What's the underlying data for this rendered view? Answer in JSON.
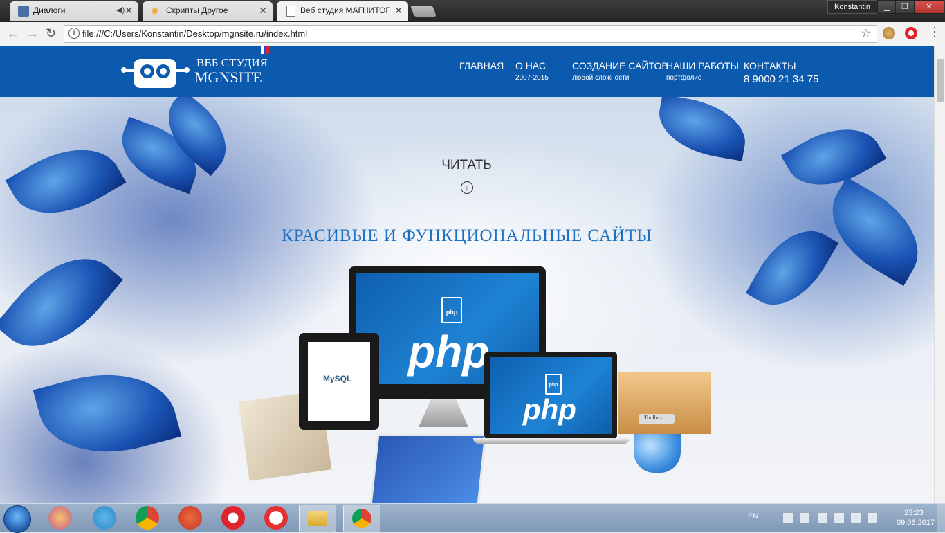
{
  "browser": {
    "tabs": [
      {
        "title": "Диалоги",
        "active": false,
        "audio": true
      },
      {
        "title": "Скрипты Другое",
        "active": false
      },
      {
        "title": "Веб студия МАГНИТОГС",
        "active": true
      }
    ],
    "user": "Konstantin",
    "url": "file:///C:/Users/Konstantin/Desktop/mgnsite.ru/index.html"
  },
  "site": {
    "logo_line1": "ВЕБ СТУДИЯ",
    "logo_line2": "MGNSITE",
    "nav": [
      {
        "label": "ГЛАВНАЯ",
        "sub": ""
      },
      {
        "label": "О НАС",
        "sub": "2007-2015"
      },
      {
        "label": "СОЗДАНИЕ САЙТОВ",
        "sub": "любой сложности"
      },
      {
        "label": "НАШИ РАБОТЫ",
        "sub": "портфолио"
      },
      {
        "label": "КОНТАКТЫ",
        "sub": "8 9000 21 34 75"
      }
    ],
    "read_label": "ЧИТАТЬ",
    "slogan": "КРАСИВЫЕ И ФУНКЦИОНАЛЬНЫЕ САЙТЫ",
    "hero": {
      "monitor_logo": "php",
      "file_icon": "php",
      "laptop_logo": "php",
      "tablet_logo": "MySQL",
      "toolbox_label": "Toolbox"
    }
  },
  "taskbar": {
    "language": "EN",
    "time": "23:23",
    "date": "09.06.2017"
  },
  "colors": {
    "header_bg": "#0c5aae",
    "slogan": "#1b6fc0"
  }
}
